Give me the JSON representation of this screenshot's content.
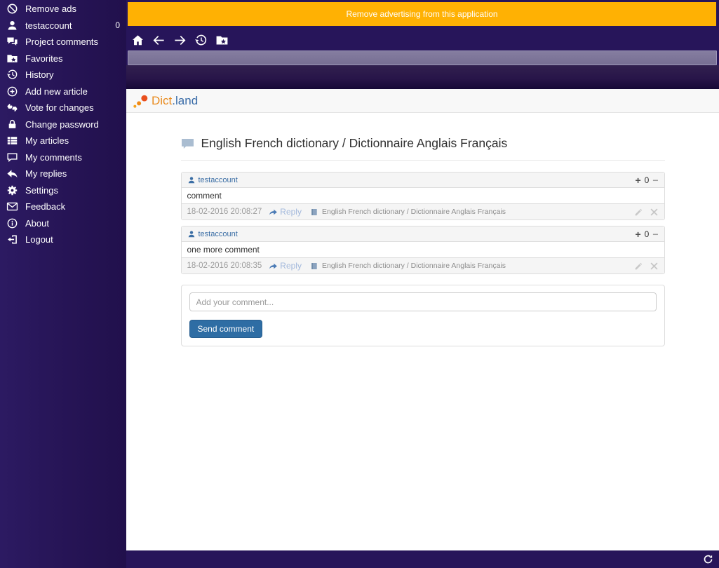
{
  "colors": {
    "accent_orange": "#FFB103",
    "sidebar_purple": "#27155A",
    "link_blue": "#3B6EA5",
    "button_blue": "#2E6DA4",
    "logo_orange": "#E98B1F",
    "logo_blue": "#3A6CA8"
  },
  "banner": {
    "text": "Remove advertising from this application"
  },
  "sidebar": {
    "items": [
      {
        "icon": "no-ads-icon",
        "label": "Remove ads"
      },
      {
        "icon": "user-icon",
        "label": "testaccount",
        "badge": "0"
      },
      {
        "icon": "chat-icon",
        "label": "Project comments"
      },
      {
        "icon": "folder-star-icon",
        "label": "Favorites"
      },
      {
        "icon": "history-icon",
        "label": "History"
      },
      {
        "icon": "add-circle-icon",
        "label": "Add new article"
      },
      {
        "icon": "vote-thumbs-icon",
        "label": "Vote for changes"
      },
      {
        "icon": "lock-icon",
        "label": "Change password"
      },
      {
        "icon": "list-icon",
        "label": "My articles"
      },
      {
        "icon": "comment-icon",
        "label": "My comments"
      },
      {
        "icon": "reply-icon",
        "label": "My replies"
      },
      {
        "icon": "gear-icon",
        "label": "Settings"
      },
      {
        "icon": "envelope-icon",
        "label": "Feedback"
      },
      {
        "icon": "info-icon",
        "label": "About"
      },
      {
        "icon": "logout-icon",
        "label": "Logout"
      }
    ]
  },
  "toolbar": {
    "icons": [
      "home-icon",
      "back-icon",
      "forward-icon",
      "history-icon",
      "favorites-folder-icon"
    ]
  },
  "addressbar": {
    "value": ""
  },
  "content": {
    "logo": {
      "part1": "Dict",
      "part2": ".land"
    },
    "heading": "English French dictionary / Dictionnaire Anglais Français",
    "vote": {
      "up_glyph": "+",
      "down_glyph": "−"
    },
    "comments": [
      {
        "author": "testaccount",
        "votes": "0",
        "body": "comment",
        "timestamp": "18-02-2016 20:08:27",
        "reply_label": "Reply",
        "article": "English French dictionary / Dictionnaire Anglais Français"
      },
      {
        "author": "testaccount",
        "votes": "0",
        "body": "one more comment",
        "timestamp": "18-02-2016 20:08:35",
        "reply_label": "Reply",
        "article": "English French dictionary / Dictionnaire Anglais Français"
      }
    ],
    "form": {
      "placeholder": "Add your comment...",
      "submit_label": "Send comment"
    }
  }
}
